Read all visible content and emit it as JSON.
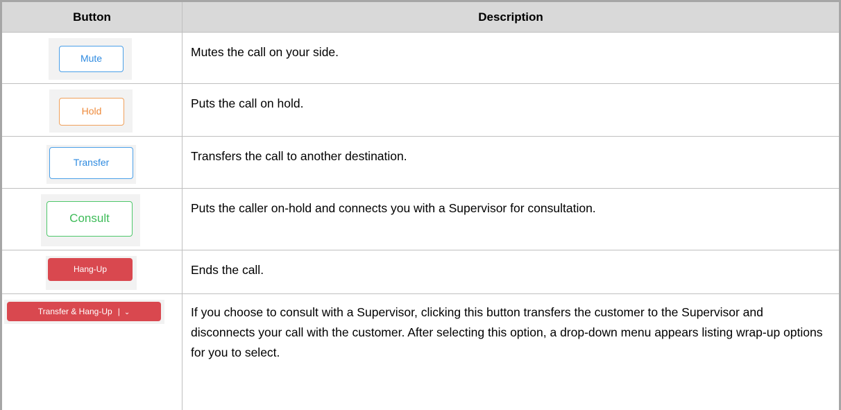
{
  "table": {
    "headers": {
      "button": "Button",
      "description": "Description"
    },
    "rows": [
      {
        "button_label": "Mute",
        "description": "Mutes the call on your side."
      },
      {
        "button_label": "Hold",
        "description": "Puts the call on hold."
      },
      {
        "button_label": "Transfer",
        "description": "Transfers the call to another destination."
      },
      {
        "button_label": "Consult",
        "description": "Puts the caller on-hold and connects you with a Supervisor for consultation."
      },
      {
        "button_label": "Hang-Up",
        "description": "Ends the call."
      },
      {
        "button_label": "Transfer & Hang-Up",
        "separator": "|",
        "description": "If you choose to consult with a Supervisor, clicking this button transfers the customer to the Supervisor and disconnects your call with the customer. After selecting this option, a drop-down menu appears listing wrap-up options for you to select."
      }
    ]
  },
  "icons": {
    "dropdown": "chevron-down-icon"
  },
  "colors": {
    "header_bg": "#d9d9d9",
    "mute_blue": "#2f8be0",
    "hold_orange": "#ee8a3a",
    "consult_green": "#3dbb58",
    "hangup_red": "#d9484f"
  }
}
